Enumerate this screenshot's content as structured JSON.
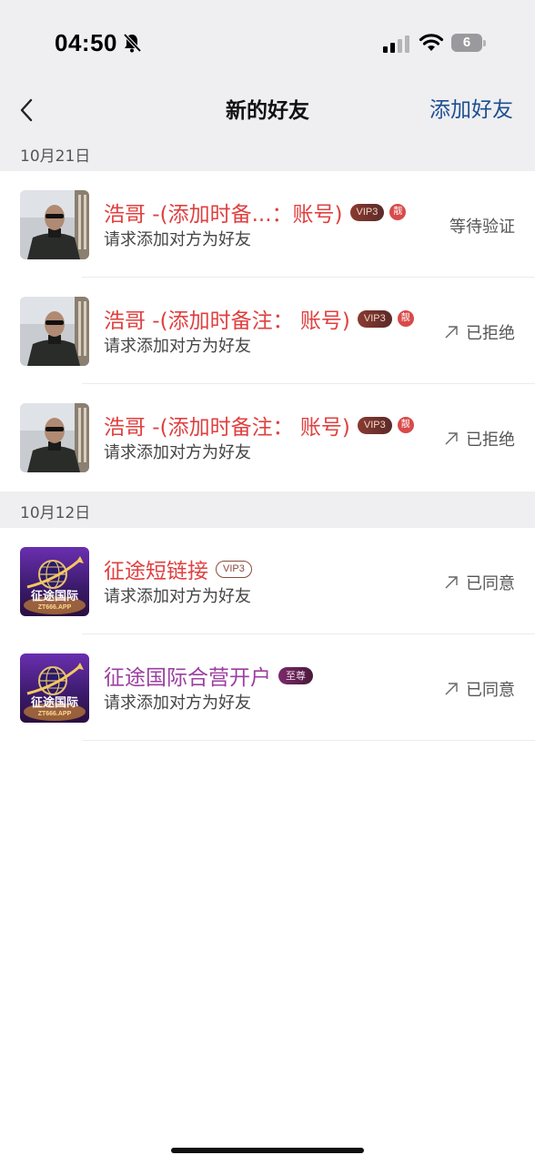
{
  "status_bar": {
    "time": "04:50",
    "battery": "6",
    "icons": [
      "bell-slash-icon",
      "cellular-signal-icon",
      "wifi-icon",
      "battery-icon"
    ]
  },
  "nav": {
    "back_icon": "chevron-left-icon",
    "title": "新的好友",
    "add_friend": "添加好友"
  },
  "sections": [
    {
      "date": "10月21日",
      "requests": [
        {
          "name": "浩哥 -(添加时备...：账号)",
          "vip": "VIP3",
          "liang": "靓",
          "message": "请求添加对方为好友",
          "status": "等待验证"
        },
        {
          "name": "浩哥 -(添加时备注： 账号)",
          "vip": "VIP3",
          "liang": "靓",
          "message": "请求添加对方为好友",
          "status": "已拒绝"
        },
        {
          "name": "浩哥 -(添加时备注： 账号)",
          "vip": "VIP3",
          "liang": "靓",
          "message": "请求添加对方为好友",
          "status": "已拒绝"
        }
      ]
    },
    {
      "date": "10月12日",
      "requests": [
        {
          "name": "征途短链接",
          "vip": "VIP3",
          "message": "请求添加对方为好友",
          "status": "已同意"
        },
        {
          "name": "征途国际合营开户",
          "badge": "至尊",
          "message": "请求添加对方为好友",
          "status": "已同意"
        }
      ]
    }
  ],
  "logo_text": {
    "line1": "征途国际",
    "line2": "ZT666.APP"
  },
  "colors": {
    "accent_blue": "#1d4f91",
    "name_red": "#e04040",
    "name_purple": "#9b3fa0",
    "section_bg": "#efeff1"
  }
}
